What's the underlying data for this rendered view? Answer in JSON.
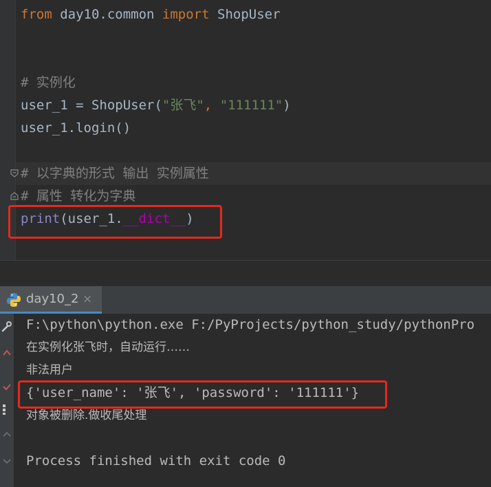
{
  "editor": {
    "line1": {
      "kw1": "from",
      "mod": " day10.common ",
      "kw2": "import",
      "cls": " ShopUser"
    },
    "line2": {
      "comment": "# 实例化"
    },
    "line3": {
      "var": "user_1 = ShopUser(",
      "s1": "\"张飞\"",
      "comma": ", ",
      "s2": "\"111111\"",
      "close": ")"
    },
    "line4": {
      "text": "user_1.login()"
    },
    "line5": {
      "comment": "# 以字典的形式 输出 实例属性"
    },
    "line6": {
      "comment": "# 属性 转化为字典"
    },
    "line7": {
      "fn": "print",
      "open": "(user_1.",
      "dunder": "__dict__",
      "close": ")"
    }
  },
  "run_panel": {
    "tab_label": "day10_2",
    "tab_close": "×",
    "output": [
      "F:\\python\\python.exe F:/PyProjects/python_study/pythonPro",
      "在实例化张飞时，自动运行……",
      "非法用户",
      "{'user_name': '张飞', 'password': '111111'}",
      "对象被删除.做收尾处理",
      "",
      "Process finished with exit code 0"
    ]
  },
  "colors": {
    "highlight_box": "#e8281c",
    "tab_underline": "#4a88c7",
    "background": "#2b2b2b"
  }
}
